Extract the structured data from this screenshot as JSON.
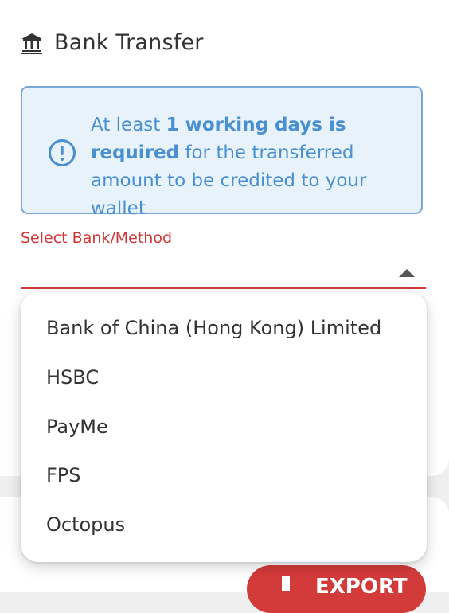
{
  "header": {
    "icon": "bank-icon",
    "title": "Bank Transfer"
  },
  "notice": {
    "icon": "info-icon",
    "prefix": "At least ",
    "bold": "1 working days is required",
    "suffix": " for the transferred amount to be credited to your wallet",
    "colors": {
      "background": "#e8f2fb",
      "border": "#7aa8d6",
      "text": "#4a8fd0"
    }
  },
  "select": {
    "label": "Select Bank/Method",
    "accent": "#d33b3b",
    "caret_icon": "caret-up-icon"
  },
  "dropdown": {
    "options": [
      "Bank of China (Hong Kong) Limited",
      "HSBC",
      "PayMe",
      "FPS",
      "Octopus"
    ]
  },
  "export": {
    "label": "EXPORT",
    "icon": "download-icon",
    "color": "#d33b3b"
  }
}
